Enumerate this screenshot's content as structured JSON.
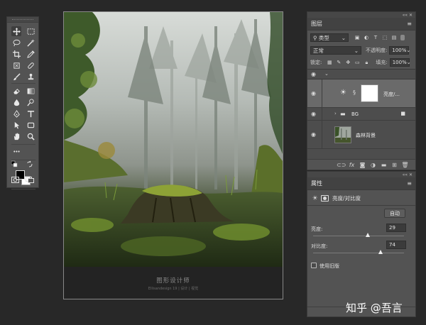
{
  "toolbar": {
    "tools": [
      "move-tool",
      "marquee-tool",
      "lasso-tool",
      "magic-wand-tool",
      "crop-tool",
      "eyedropper-tool",
      "frame-tool",
      "healing-brush-tool",
      "brush-tool",
      "clone-stamp-tool",
      "eraser-tool",
      "gradient-tool",
      "blur-tool",
      "dodge-tool",
      "pen-tool",
      "type-tool",
      "path-selection-tool",
      "shape-tool",
      "hand-tool",
      "zoom-tool"
    ],
    "more_label": "•••",
    "foreground_color": "#000000",
    "background_color": "#ffffff"
  },
  "canvas": {
    "caption_title": "图形设计师",
    "caption_sub": "Ellisandesign  19 | 设计 | 视觉"
  },
  "layers_panel": {
    "title": "图层",
    "filter_select": "类型",
    "blend_mode": "正常",
    "opacity_label": "不透明度:",
    "opacity_value": "100%",
    "lock_label": "锁定:",
    "fill_label": "填充:",
    "fill_value": "100%",
    "layers": [
      {
        "name": "亮度/...",
        "type": "adjustment",
        "selected": true
      },
      {
        "name": "BG",
        "type": "group",
        "selected": false
      },
      {
        "name": "森林背景",
        "type": "image",
        "selected": false
      }
    ]
  },
  "properties_panel": {
    "title": "属性",
    "adjustment_name": "亮度/对比度",
    "auto_label": "自动",
    "brightness_label": "亮度:",
    "brightness_value": "29",
    "brightness_fraction": 0.6,
    "contrast_label": "对比度:",
    "contrast_value": "74",
    "contrast_fraction": 0.74,
    "legacy_label": "使用旧版"
  },
  "watermark": "知乎 @吾言"
}
